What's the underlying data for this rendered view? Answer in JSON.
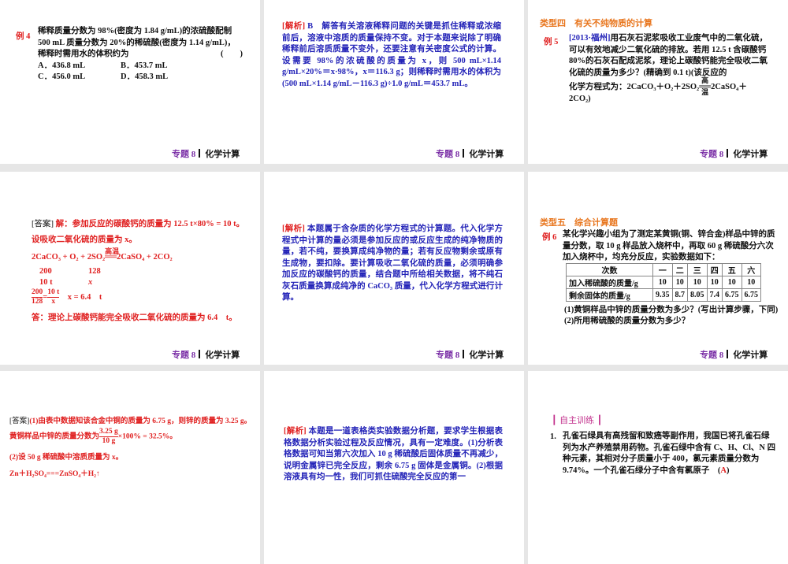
{
  "footer": {
    "topic": "专题 8",
    "title": "化学计算"
  },
  "s1": {
    "label": "例 4",
    "lines": [
      "稀释质量分数为 98%(密度为 1.84 g/mL)的浓硫酸配制",
      "500 mL 质量分数为 20%的稀硫酸(密度为 1.14 g/mL)，",
      "稀释时需用水的体积约为"
    ],
    "paren": "(　　)",
    "options": [
      "A．436.8 mL",
      "B．453.7 mL",
      "C．456.0 mL",
      "D．458.3 mL"
    ]
  },
  "s2": {
    "tag": "[解析]",
    "answer": "B",
    "text": "解答有关溶液稀释问题的关键是抓住稀释或浓缩前后，溶液中溶质的质量保持不变。对于本题来说除了明确稀释前后溶质质量不变外，还要注意有关密度公式的计算。设需要 98%的浓硫酸的质量为 x，则 500 mL×1.14 g/mL×20%＝x·98%，x＝116.3 g；则稀释时需用水的体积为(500 mL×1.14 g/mL－116.3 g)÷1.0 g/mL＝453.7 mL。"
  },
  "s3": {
    "heading": "类型四　有关不纯物质的计算",
    "label": "例 5",
    "source": "[2013·福州]",
    "text": "用石灰石泥浆吸收工业废气中的二氧化硫，可以有效地减少二氧化硫的排放。若用 12.5 t 含碳酸钙 80%的石灰石配成泥浆，理论上碳酸钙能完全吸收二氧化硫的质量为多少？(精确到 0.1 t)(该反应的",
    "eq_prefix": "化学方程式为：2CaCO₃＋O₂＋2SO₂",
    "cond": "高温",
    "eq_suffix": "2CaSO₄＋",
    "eq_end": "2CO₂)"
  },
  "s4": {
    "tag": "[答案]",
    "l1": "解：参加反应的碳酸钙的质量为 12.5 t×80% = 10 t。",
    "l2": "设吸收二氧化硫的质量为 x。",
    "eq_left": "2CaCO₃ + O₂ + 2SO₂",
    "cond": "高温",
    "eq_right": "2CaSO₄ + 2CO₂",
    "r1a": "200",
    "r1b": "128",
    "r2a": "10 t",
    "r2b": "x",
    "f1n": "200",
    "f1d": "128",
    "f2n": "10 t",
    "f2d": "x",
    "result": "x = 6.4　t",
    "ans": "答：理论上碳酸钙能完全吸收二氧化硫的质量为 6.4　t。"
  },
  "s5": {
    "tag": "[解析]",
    "text": "本题属于含杂质的化学方程式的计算题。代入化学方程式中计算的量必须是参加反应的或反应生成的纯净物质的量，若不纯，要换算成纯净物的量；若有反应物剩余或原有生成物，要扣除。要计算吸收二氧化硫的质量，必须明确参加反应的碳酸钙的质量，结合题中所给相关数据，将不纯石灰石质量换算成纯净的 CaCO₃ 质量，代入化学方程式进行计算。"
  },
  "s6": {
    "heading": "类型五　综合计算题",
    "label": "例 6",
    "text": "某化学兴趣小组为了测定某黄铜(铜、锌合金)样品中锌的质量分数，取 10 g 样品放入烧杯中，再取 60 g 稀硫酸分六次加入烧杯中，均充分反应，实验数据如下：",
    "table": {
      "header": [
        "次数",
        "一",
        "二",
        "三",
        "四",
        "五",
        "六"
      ],
      "rows": [
        [
          "加入稀硫酸的质量/g",
          "10",
          "10",
          "10",
          "10",
          "10",
          "10"
        ],
        [
          "剩余固体的质量/g",
          "9.35",
          "8.7",
          "8.05",
          "7.4",
          "6.75",
          "6.75"
        ]
      ]
    },
    "q1": "(1)黄铜样品中锌的质量分数为多少？(写出计算步骤，下同)",
    "q2": "(2)所用稀硫酸的质量分数为多少？"
  },
  "s7": {
    "tag": "[答案]",
    "l1": "(1)由表中数据知该合金中铜的质量为 6.75 g，则锌的质量为 3.25 g。",
    "l2a": "黄铜样品中锌的质量分数为",
    "fn": "3.25 g",
    "fd": "10 g",
    "l2b": "×100% = 32.5%。",
    "l3": "(2)设 50 g 稀硫酸中溶质质量为 x。",
    "l4": "Zn＋H₂SO₄===ZnSO₄＋H₂↑"
  },
  "s8": {
    "tag": "[解析]",
    "text": "本题是一道表格类实验数据分析题，要求学生根据表格数据分析实验过程及反应情况，具有一定难度。(1)分析表格数据可知当第六次加入 10 g 稀硫酸后固体质量不再减少，说明金属锌已完全反应，剩余 6.75 g 固体是金属铜。(2)根据溶液具有均一性，我们可抓住硫酸完全反应的第一"
  },
  "s9": {
    "heading": "自主训练",
    "num": "1.",
    "text": "孔雀石绿具有高残留和致癌等副作用，我国已将孔雀石绿列为水产养殖禁用药物。孔雀石绿中含有 C、H、Cl、N 四种元素，其相对分子质量小于 400，氯元素质量分数为 9.74%。一个孔雀石绿分子中含有氯原子",
    "answer": "A"
  }
}
